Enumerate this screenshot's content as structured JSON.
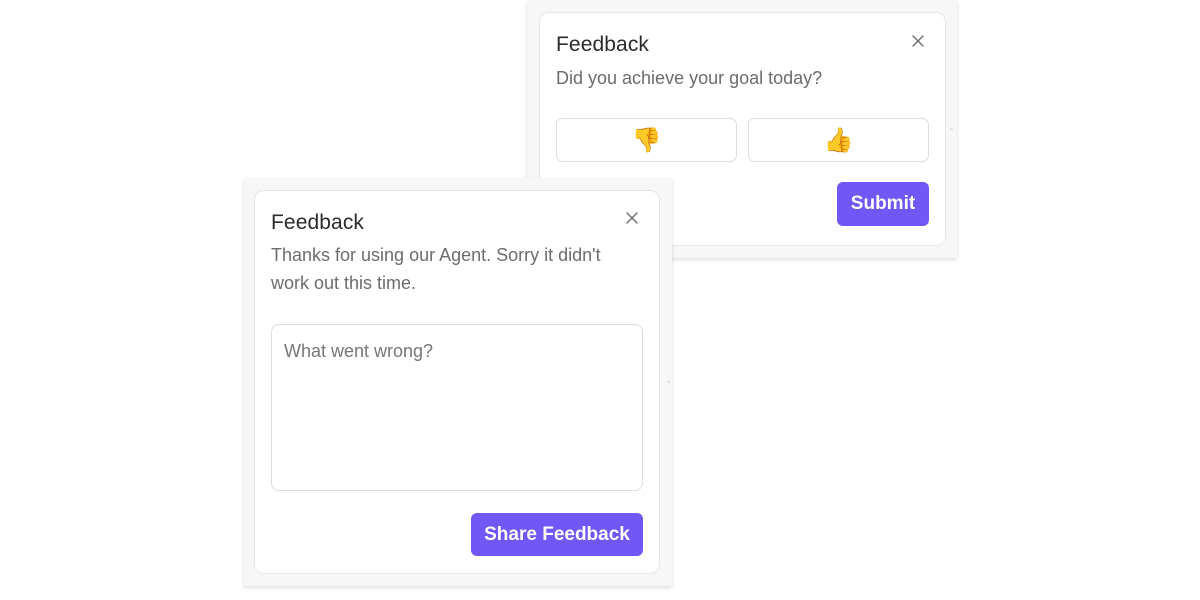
{
  "top_dialog": {
    "title": "Feedback",
    "question": "Did you achieve your goal today?",
    "thumbs_down": "👎",
    "thumbs_up": "👍",
    "submit_label": "Submit"
  },
  "bottom_dialog": {
    "title": "Feedback",
    "message": "Thanks for using our Agent. Sorry it didn't work out this time.",
    "textarea_placeholder": "What went wrong?",
    "textarea_value": "",
    "share_label": "Share Feedback"
  },
  "colors": {
    "accent": "#7257f7",
    "title_text": "#2b2b2d",
    "body_text": "#6c6c70",
    "border": "#dcdce0"
  }
}
